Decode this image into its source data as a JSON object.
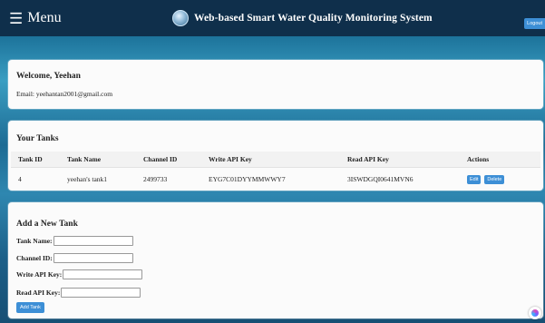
{
  "header": {
    "menu_icon": "☰",
    "menu_label": "Menu",
    "title": "Web-based Smart Water Quality Monitoring System",
    "logout_label": "Logout",
    "logo_icon": "water-globe-icon"
  },
  "welcome": {
    "heading": "Welcome, Yeehan",
    "email": "Email: yeehantan2001@gmail.com"
  },
  "tanks": {
    "heading": "Your Tanks",
    "columns": [
      "Tank ID",
      "Tank Name",
      "Channel ID",
      "Write API Key",
      "Read API Key",
      "Actions"
    ],
    "rows": [
      {
        "tank_id": "4",
        "tank_name": "yeehan's tank1",
        "channel_id": "2499733",
        "write_key": "EYG7C01DYYMMWWY7",
        "read_key": "3ISWDGQI0641MVN6",
        "edit_label": "Edit",
        "delete_label": "Delete"
      }
    ]
  },
  "add_tank": {
    "heading": "Add a New Tank",
    "tank_name_label": "Tank Name:",
    "channel_id_label": "Channel ID:",
    "write_key_label": "Write API Key:",
    "read_key_label": "Read API Key:",
    "submit_label": "Add Tank"
  },
  "colors": {
    "header_bg": "#0f2f4b",
    "button_bg": "#3d8fd6"
  }
}
